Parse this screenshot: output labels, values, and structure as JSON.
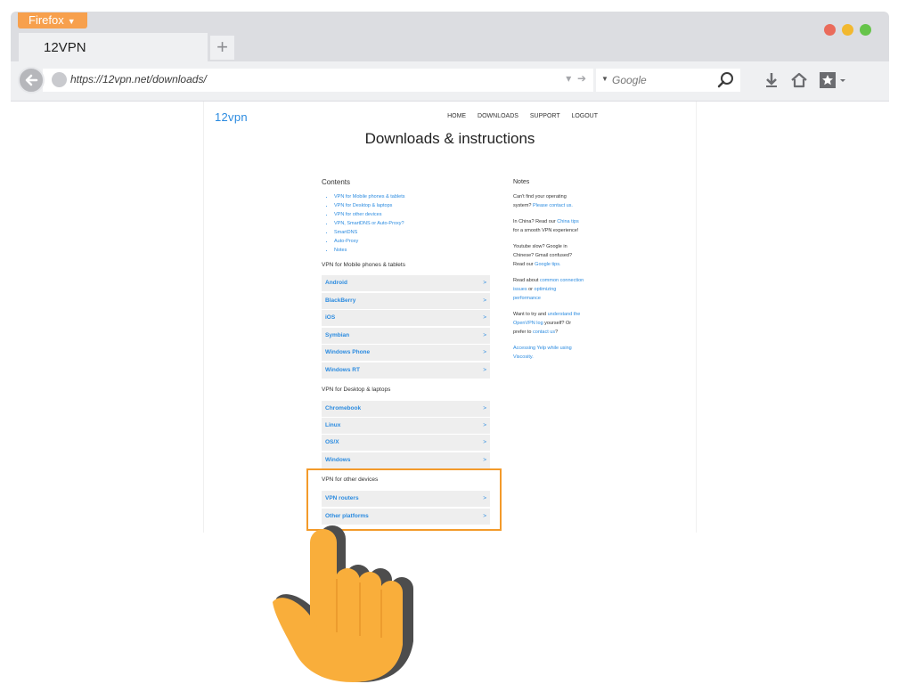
{
  "browser": {
    "menu_label": "Firefox",
    "tab_title": "12VPN",
    "new_tab_label": "+",
    "url": "https://12vpn.net/downloads/",
    "search_placeholder": "Google",
    "window_dots": [
      "#ea6b5b",
      "#f2b82f",
      "#66c44a"
    ]
  },
  "page": {
    "logo": "12vpn",
    "nav": [
      "HOME",
      "DOWNLOADS",
      "SUPPORT",
      "LOGOUT"
    ],
    "title": "Downloads & instructions",
    "contents_title": "Contents",
    "contents": [
      "VPN for Mobile phones & tablets",
      "VPN for Desktop & laptops",
      "VPN for other devices",
      "VPN, SmartDNS or Auto-Proxy?",
      "SmartDNS",
      "Auto-Proxy",
      "Notes"
    ],
    "sections": [
      {
        "label": "VPN for Mobile phones & tablets",
        "items": [
          "Android",
          "BlackBerry",
          "iOS",
          "Symbian",
          "Windows Phone",
          "Windows RT"
        ]
      },
      {
        "label": "VPN for Desktop & laptops",
        "items": [
          "Chromebook",
          "Linux",
          "OS/X",
          "Windows"
        ]
      },
      {
        "label": "VPN for other devices",
        "items": [
          "VPN routers",
          "Other platforms"
        ]
      }
    ],
    "arrow": ">",
    "notes": {
      "title": "Notes",
      "n1_text": "Can't find your operating system?",
      "n1_link": "Please contact us.",
      "n2_pre": "In China? Read our",
      "n2_link": "China tips",
      "n2_post": "for a smooth VPN experience!",
      "n3_text": "Youtube slow? Google in Chinese? Gmail confused? Read our",
      "n3_link": "Google tips.",
      "n4_pre": "Read about",
      "n4_link1": "common connection issues",
      "n4_mid": "or",
      "n4_link2": "optimizing performance",
      "n5_pre": "Want to try and",
      "n5_link1": "understand the OpenVPN log",
      "n5_mid": "yourself? Or prefer to",
      "n5_link2": "contact us",
      "n5_post": "?",
      "n6_link": "Accessing Yelp while using Viscosity."
    }
  },
  "colors": {
    "accent": "#2b8be0",
    "highlight": "#f39a2a",
    "hand": "#f9ae3b"
  }
}
